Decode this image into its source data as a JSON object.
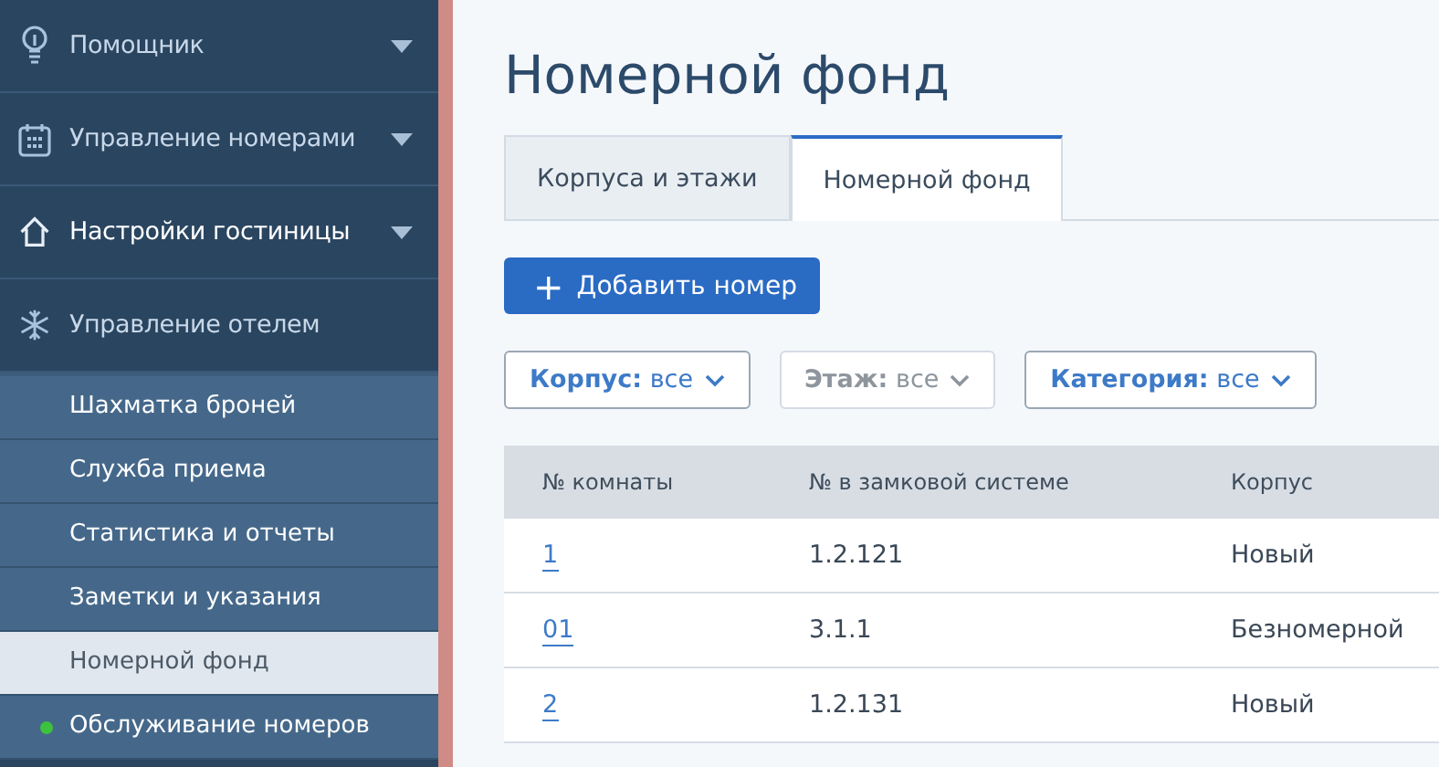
{
  "sidebar": {
    "menu": [
      {
        "label": "Помощник",
        "expanded": false
      },
      {
        "label": "Управление номерами",
        "expanded": false
      },
      {
        "label": "Настройки гостиницы",
        "expanded": false
      },
      {
        "label": "Управление отелем",
        "expanded": true
      }
    ],
    "submenu": [
      {
        "label": "Шахматка броней",
        "selected": false
      },
      {
        "label": "Служба приема",
        "selected": false
      },
      {
        "label": "Статистика и отчеты",
        "selected": false
      },
      {
        "label": "Заметки и указания",
        "selected": false
      },
      {
        "label": "Номерной фонд",
        "selected": true
      },
      {
        "label": "Обслуживание номеров",
        "selected": false,
        "color": "#3cc23c"
      }
    ]
  },
  "page": {
    "title": "Номерной фонд",
    "tabs": [
      {
        "label": "Корпуса и этажи",
        "selected": false
      },
      {
        "label": "Номерной фонд",
        "selected": true
      }
    ],
    "add_button": {
      "icon": "+",
      "label": "Добавить номер"
    },
    "filters": [
      {
        "label": "Корпус:",
        "value": "все",
        "disabled": false
      },
      {
        "label": "Этаж:",
        "value": "все",
        "disabled": true
      },
      {
        "label": "Категория:",
        "value": "все",
        "disabled": false
      }
    ],
    "table": {
      "columns": [
        "№ комнаты",
        "№ в замковой системе",
        "Корпус"
      ],
      "rows": [
        [
          "1",
          "1.2.121",
          "Новый"
        ],
        [
          "01",
          "3.1.1",
          "Безномерной"
        ],
        [
          "2",
          "1.2.131",
          "Новый"
        ]
      ]
    }
  }
}
